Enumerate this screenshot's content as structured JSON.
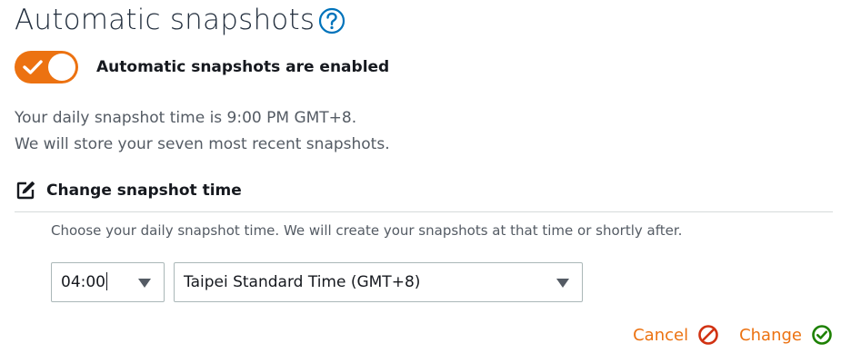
{
  "header": {
    "title": "Automatic snapshots",
    "help_icon": "question-circle-icon"
  },
  "toggle": {
    "state": "on",
    "label": "Automatic snapshots are enabled",
    "color": "#ec7211"
  },
  "info": {
    "line1": "Your daily snapshot time is 9:00 PM GMT+8.",
    "line2": "We will store your seven most recent snapshots."
  },
  "change_section": {
    "icon": "edit-icon",
    "title": "Change snapshot time",
    "instruction": "Choose your daily snapshot time. We will create your snapshots at that time or shortly after."
  },
  "time_select": {
    "value": "04:00"
  },
  "timezone_select": {
    "value": "Taipei Standard Time (GMT+8)"
  },
  "actions": {
    "cancel_label": "Cancel",
    "change_label": "Change",
    "cancel_icon": "cancel-circle-icon",
    "change_icon": "check-circle-icon",
    "link_color": "#ec7211",
    "cancel_icon_color": "#d13212",
    "change_icon_color": "#1d8102"
  }
}
